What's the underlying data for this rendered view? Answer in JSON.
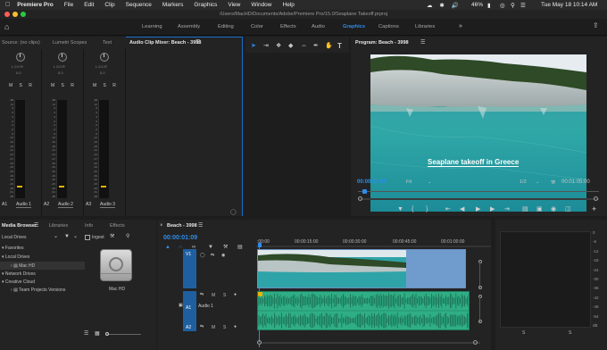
{
  "menubar": {
    "app_name": "Premiere Pro",
    "items": [
      "File",
      "Edit",
      "Clip",
      "Sequence",
      "Markers",
      "Graphics",
      "View",
      "Window",
      "Help"
    ],
    "battery": "46%",
    "clock": "Tue May 18  10:14 AM"
  },
  "title": "/Users/MacHD/Documents/Adobe/Premiere Pro/15.0/Seaplane Takeoff.prproj",
  "workspaces": {
    "items": [
      "Learning",
      "Assembly",
      "Editing",
      "Color",
      "Effects",
      "Audio",
      "Graphics",
      "Captions",
      "Libraries"
    ],
    "active": "Graphics"
  },
  "source_panel": {
    "tabs": [
      "Source: (no clips)",
      "Lumetri Scopes",
      "Text",
      "Audio Clip Mixer: Beach - 3998"
    ],
    "knob_label_a": "L  0.0  R",
    "knob_value": "0.0",
    "msr": "M  S  R",
    "ruler": [
      "dB",
      "12",
      "9",
      "6",
      "3",
      "0",
      "-3",
      "-6",
      "-9",
      "-12",
      "-15",
      "-18",
      "-21",
      "-24",
      "-27",
      "-30",
      "-33",
      "-36",
      "-39",
      "-42",
      "-45",
      "-48",
      "-51",
      "dB"
    ],
    "channels": [
      {
        "id": "A1",
        "name": "Audio 1"
      },
      {
        "id": "A2",
        "name": "Audio 2"
      },
      {
        "id": "A3",
        "name": "Audio 3"
      }
    ]
  },
  "program_monitor": {
    "title": "Program: Beach - 3998",
    "caption": "Seaplane takeoff in Greece",
    "timecode": "00:00:01:09",
    "fit": "Fit",
    "resolution": "1/2",
    "duration": "00:01:05:00"
  },
  "media_browser": {
    "tabs": [
      "Media Browser",
      "Libraries",
      "Info",
      "Effects"
    ],
    "location": "Local Drives",
    "ingest_label": "Ingest",
    "tree": [
      "Favorites",
      "Local Drives",
      "Mac HD",
      "Network Drives",
      "Creative Cloud",
      "Team Projects Versions"
    ],
    "drive_label": "Mac HD"
  },
  "timeline": {
    "title": "Beach - 3998",
    "timecode": "00:00:01:09",
    "ruler": [
      ":00:00",
      "00:00:15:00",
      "00:00:30:00",
      "00:00:45:00",
      "00:01:00:00"
    ],
    "tracks": {
      "v1": "V1",
      "a1": "A1",
      "a1_name": "Audio 1",
      "a2": "A2",
      "toggle_m": "M",
      "toggle_s": "S"
    }
  },
  "audio_meter": {
    "labels": [
      "0",
      "-6",
      "-12",
      "-18",
      "-24",
      "-30",
      "-36",
      "-42",
      "-48",
      "-54",
      "dB"
    ],
    "channels": [
      "S",
      "S"
    ]
  },
  "colors": {
    "accent": "#2d8ceb",
    "audio_clip": "#2fae85",
    "video_track": "#1f5fa0",
    "fader": "#e8b400"
  }
}
